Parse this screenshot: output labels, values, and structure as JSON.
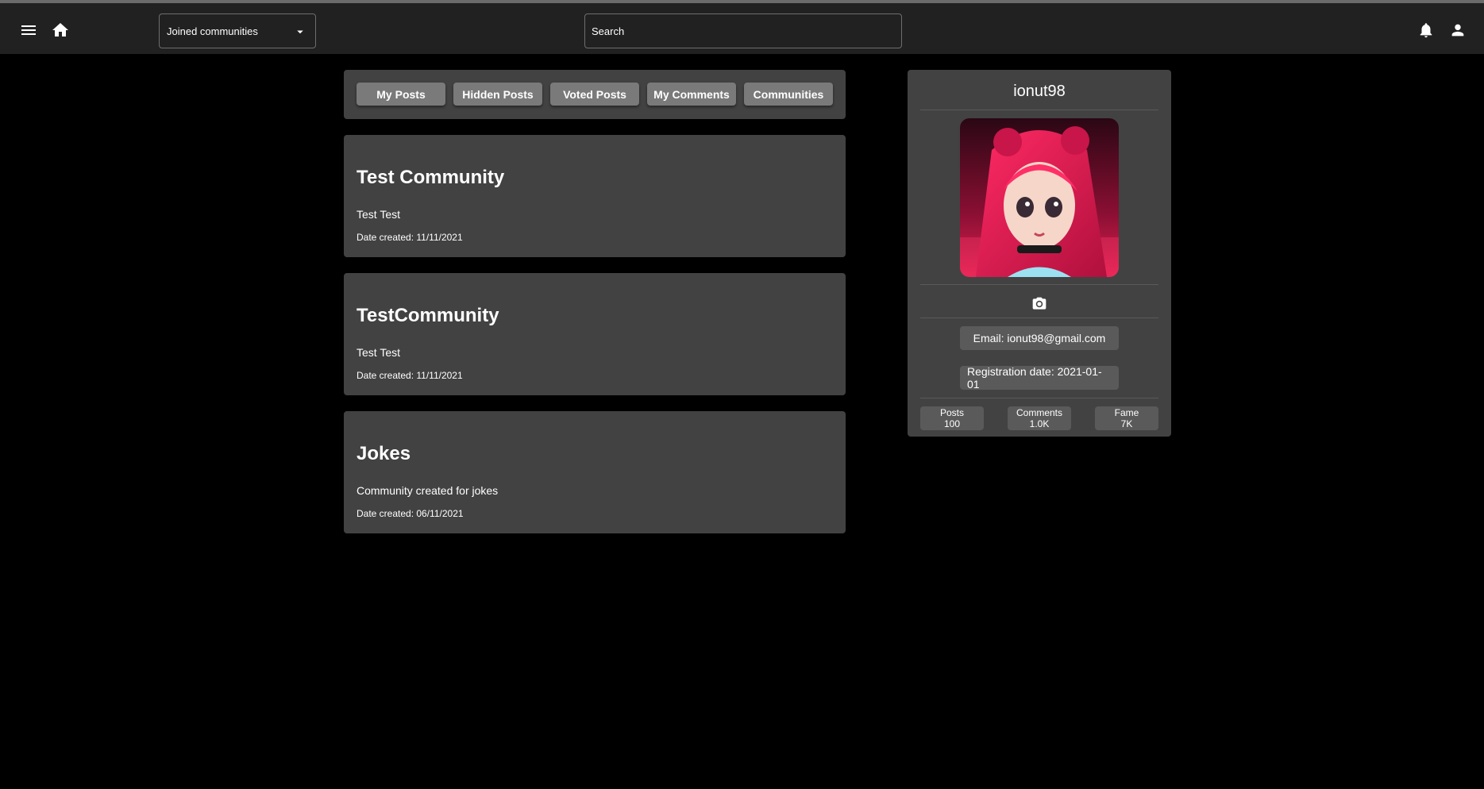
{
  "header": {
    "community_select": {
      "value": "Joined communities"
    },
    "search": {
      "placeholder": "Search"
    }
  },
  "tabs": [
    {
      "label": "My Posts"
    },
    {
      "label": "Hidden Posts"
    },
    {
      "label": "Voted Posts"
    },
    {
      "label": "My Comments"
    },
    {
      "label": "Communities"
    }
  ],
  "communities": [
    {
      "name": "Test Community",
      "description": "Test Test",
      "date": "Date created: 11/11/2021"
    },
    {
      "name": "TestCommunity",
      "description": "Test Test",
      "date": "Date created: 11/11/2021"
    },
    {
      "name": "Jokes",
      "description": "Community created for jokes",
      "date": "Date created: 06/11/2021"
    }
  ],
  "profile": {
    "username": "ionut98",
    "email": "Email: ionut98@gmail.com",
    "registration": "Registration date: 2021-01-01",
    "stats": [
      {
        "label": "Posts",
        "value": "100"
      },
      {
        "label": "Comments",
        "value": "1.0K"
      },
      {
        "label": "Fame",
        "value": "7K"
      }
    ]
  },
  "icons": {
    "menu": "menu-icon",
    "home": "home-icon",
    "notifications": "bell-icon",
    "account": "account-icon",
    "dropdown": "chevron-down-icon",
    "upload_photo": "camera-icon"
  }
}
